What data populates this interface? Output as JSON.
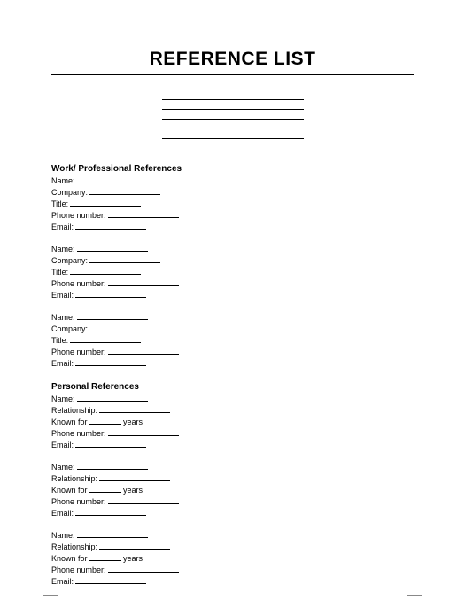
{
  "title": "REFERENCE LIST",
  "sections": {
    "work": {
      "heading": "Work/ Professional References",
      "labels": {
        "name": "Name:",
        "company": "Company:",
        "title": "Title:",
        "phone": "Phone number:",
        "email": "Email:"
      }
    },
    "personal": {
      "heading": "Personal References",
      "labels": {
        "name": "Name:",
        "relationship": "Relationship:",
        "known_prefix": "Known for",
        "known_suffix": "years",
        "phone": "Phone number:",
        "email": "Email:"
      }
    }
  }
}
